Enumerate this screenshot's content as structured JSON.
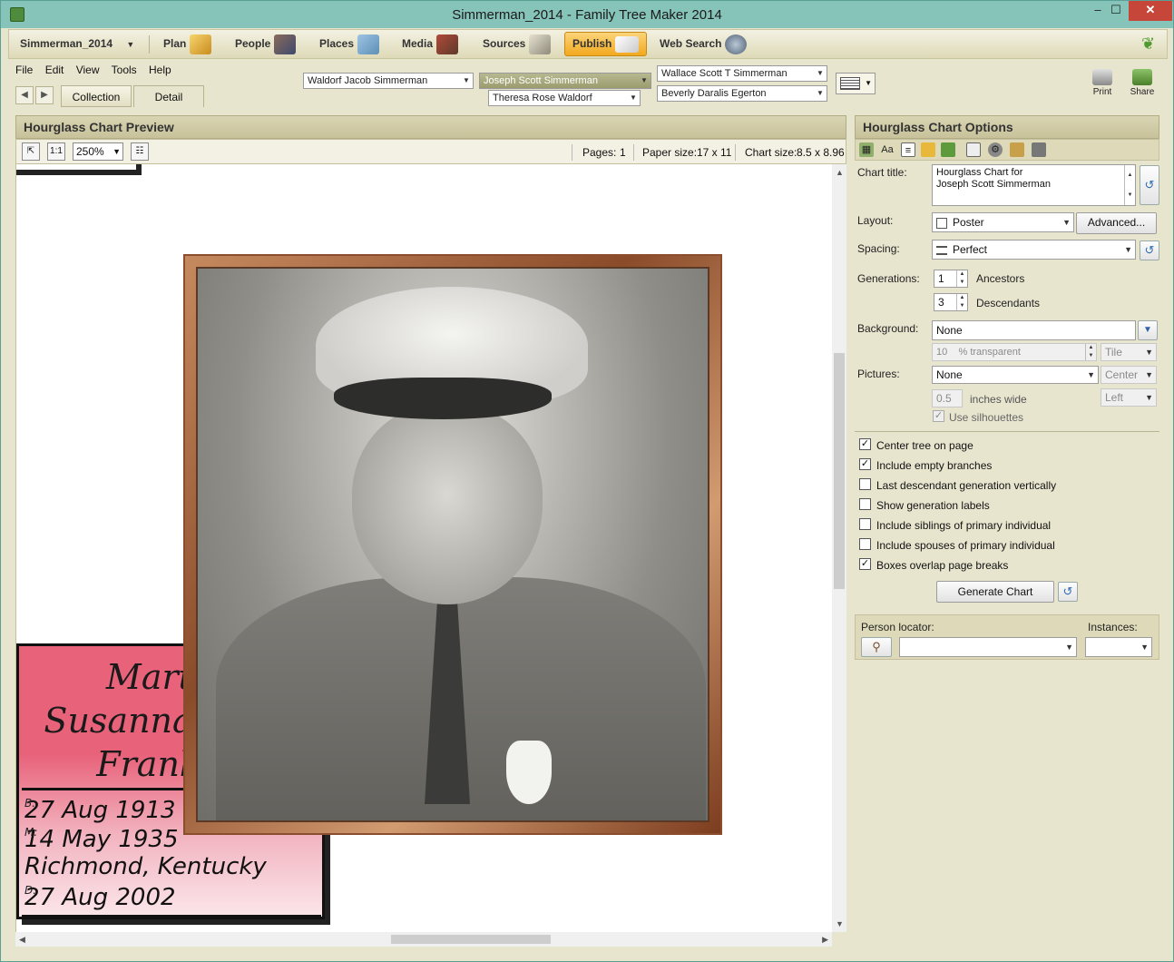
{
  "window": {
    "title": "Simmerman_2014 - Family Tree Maker 2014",
    "minimize": "–",
    "maximize": "☐",
    "close": "✕"
  },
  "nav": {
    "tree_name": "Simmerman_2014",
    "items": [
      "Plan",
      "People",
      "Places",
      "Media",
      "Sources",
      "Publish",
      "Web Search"
    ],
    "active": "Publish"
  },
  "menu": [
    "File",
    "Edit",
    "View",
    "Tools",
    "Help"
  ],
  "tabs": [
    "Collection",
    "Detail"
  ],
  "family": {
    "father": "Waldorf Jacob Simmerman",
    "primary": "Joseph Scott Simmerman",
    "mother": "Theresa Rose Waldorf",
    "spouse_father": "Wallace Scott T Simmerman",
    "spouse_mother": "Beverly Daralis Egerton"
  },
  "tools": {
    "print": "Print",
    "share": "Share"
  },
  "preview": {
    "header": "Hourglass Chart Preview",
    "zoom": "250%",
    "pages_label": "Pages:",
    "pages": "1",
    "paper_label": "Paper size:",
    "paper": "17 x 11",
    "chart_label": "Chart size:",
    "chart": "8.5 x 8.96"
  },
  "person_box": {
    "name_lines": [
      "Martha",
      "Susanna Hope",
      "Franklin"
    ],
    "facts": [
      {
        "label": "B:",
        "value": "27 Aug 1913"
      },
      {
        "label": "M:",
        "value": "14 May 1935"
      },
      {
        "label": "",
        "value": "Richmond, Kentucky"
      },
      {
        "label": "D:",
        "value": "27 Aug 2002"
      }
    ]
  },
  "options": {
    "header": "Hourglass Chart Options",
    "chart_title_label": "Chart title:",
    "chart_title_line1": "Hourglass Chart for",
    "chart_title_line2": "Joseph Scott Simmerman",
    "layout_label": "Layout:",
    "layout": "Poster",
    "advanced": "Advanced...",
    "spacing_label": "Spacing:",
    "spacing": "Perfect",
    "generations_label": "Generations:",
    "ancestors": "1",
    "ancestors_label": "Ancestors",
    "descendants": "3",
    "descendants_label": "Descendants",
    "background_label": "Background:",
    "background": "None",
    "transparency": "10",
    "transparency_label": "% transparent",
    "bg_mode": "Tile",
    "pictures_label": "Pictures:",
    "pictures": "None",
    "pic_align": "Center",
    "pic_width": "0.5",
    "pic_width_label": "inches wide",
    "pic_side": "Left",
    "silhouettes": "Use silhouettes",
    "checks": [
      {
        "label": "Center tree on page",
        "checked": true
      },
      {
        "label": "Include empty branches",
        "checked": true
      },
      {
        "label": "Last descendant generation vertically",
        "checked": false
      },
      {
        "label": "Show generation labels",
        "checked": false
      },
      {
        "label": "Include siblings of primary individual",
        "checked": false
      },
      {
        "label": "Include spouses of primary individual",
        "checked": false
      },
      {
        "label": "Boxes overlap page breaks",
        "checked": true
      }
    ],
    "generate": "Generate Chart",
    "locator_label": "Person locator:",
    "instances_label": "Instances:"
  },
  "colors": {
    "accent": "#f2a91e",
    "panel": "#e8e5cf",
    "box_pink": "#e8627a"
  }
}
